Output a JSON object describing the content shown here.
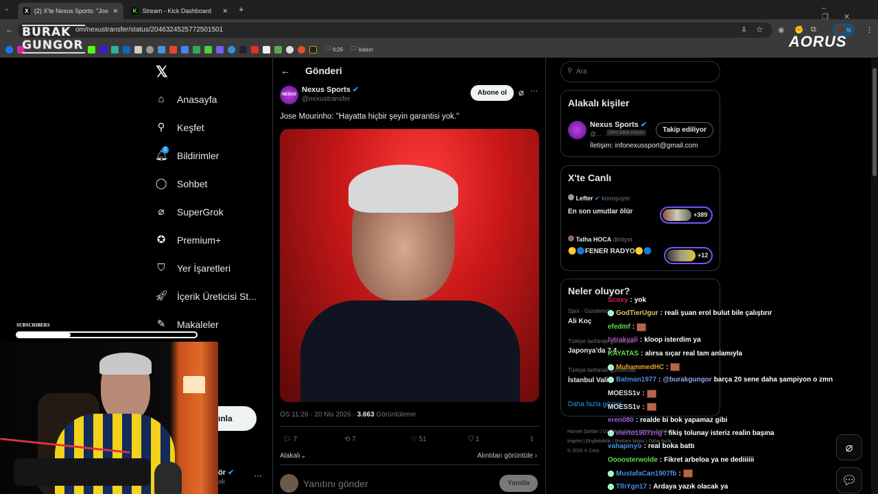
{
  "browser": {
    "tabs": [
      {
        "label": "(2) X'te Nexus Sports: \"Jose Mo",
        "icon": "x-icon",
        "active": true
      },
      {
        "label": "Stream - Kick Dashboard",
        "icon": "kick-icon",
        "active": false
      }
    ],
    "url": "x.com/nexustransfer/status/2046324525772501501",
    "url_visible": "om/nexustransfer/status/2046324525772501501",
    "bookmark_folders": [
      "fc26",
      "kalsın"
    ],
    "profile_badge": "Iş"
  },
  "overlay": {
    "streamer_logo": "BURAK GUNGOR",
    "brand_logo": "AORUS",
    "subscribers_label": "SUBSCRIBERS",
    "subscribers_progress": 0.3
  },
  "nav": {
    "items": [
      {
        "label": "Anasayfa",
        "icon": "home-icon"
      },
      {
        "label": "Keşfet",
        "icon": "search-icon"
      },
      {
        "label": "Bildirimler",
        "icon": "bell-icon",
        "badge": "2"
      },
      {
        "label": "Sohbet",
        "icon": "chat-icon"
      },
      {
        "label": "SuperGrok",
        "icon": "grok-icon"
      },
      {
        "label": "Premium+",
        "icon": "premium-icon"
      },
      {
        "label": "Yer İşaretleri",
        "icon": "bookmark-icon"
      },
      {
        "label": "İçerik Üreticisi St...",
        "icon": "rocket-icon"
      },
      {
        "label": "Makaleler",
        "icon": "article-icon"
      }
    ],
    "post_button_partial": "ınla",
    "account_name_partial": "ör",
    "account_handle_partial": "ak"
  },
  "post": {
    "header": "Gönderi",
    "author": "Nexus Sports",
    "handle": "@nexustransfer",
    "subscribe": "Abone ol",
    "text": "Jose Mourinho: \"Hayatta hiçbir şeyin garantisi yok.\"",
    "time": "ÖS 11:26 · 20 Nis 2026 · ",
    "views": "3.663",
    "views_label": "Görüntüleme",
    "replies": "7",
    "reposts": "7",
    "likes": "51",
    "bookmarks": "1",
    "sort": "Alakalı",
    "quotes": "Alıntıları görüntüle",
    "reply_placeholder": "Yanıtını gönder",
    "reply_button": "Yanıtla"
  },
  "sidebar": {
    "search_placeholder": "Ara",
    "related": {
      "title": "Alakalı kişiler",
      "name": "Nexus Sports",
      "handle": "@...",
      "follows_you": "Seni takip ediyor",
      "follow_button": "Takip ediliyor",
      "bio": "İletişim: infonexussport@gmail.com"
    },
    "live": {
      "title": "X'te Canlı",
      "spaces": [
        {
          "host": "Lefter",
          "status": "konuşuyor",
          "title": "En son umutlar ölür",
          "count": "+389"
        },
        {
          "host": "Talha HOCA",
          "status": "dinliyor",
          "title": "🟡🔵FENER RADYO🟡🔵",
          "count": "+12"
        }
      ]
    },
    "trends": {
      "title": "Neler oluyor?",
      "items": [
        {
          "context": "Spor · Gündemde",
          "name": "Ali Koç"
        },
        {
          "context": "Türkiye tarihinde gündemde",
          "name": "Japonya'da 7.4"
        },
        {
          "context": "Türkiye tarihinde gündemde",
          "name": "İstanbul Vali..."
        }
      ],
      "more": "Daha fazla göster"
    },
    "footer": [
      "Hizmet Şartları",
      "Gizlilik Politikası",
      "Çerez Politikası",
      "Imprint",
      "Erişilebilirlik",
      "Reklam bilgisi",
      "Daha fazla ...",
      "© 2026 X Corp."
    ]
  },
  "chat": [
    {
      "user": "Scoxy",
      "color": "#d0234a",
      "msg": "yok"
    },
    {
      "user": "GodTierUgur",
      "color": "#e8c26a",
      "badge": true,
      "msg": "reali şuan erol bulut bile çalıştırır"
    },
    {
      "user": "efedmf",
      "color": "#5fe04a",
      "emote": true,
      "msg": ""
    },
    {
      "user": "tvtrakyali",
      "color": "#b04cc0",
      "msg": "kloop isterdim ya"
    },
    {
      "user": "KAYATAS",
      "color": "#5fe04a",
      "msg": "alırsa sıçar real tam anlamıyla"
    },
    {
      "user": "MuhammedHC",
      "color": "#e8a030",
      "badge": true,
      "emote": true,
      "msg": ""
    },
    {
      "user": "Batman1977",
      "color": "#4a8fe0",
      "badge": true,
      "mention": "@burakgungor",
      "msg": "barça 20 sene daha şampiyon o zmn"
    },
    {
      "user": "MOESS1v",
      "color": "#dde6f0",
      "emote": true,
      "msg": ""
    },
    {
      "user": "MOESS1v",
      "color": "#dde6f0",
      "emote": true,
      "msg": ""
    },
    {
      "user": "eren080",
      "color": "#a45be0",
      "msg": "realde bi bok yapamaz gibi"
    },
    {
      "user": "merto1907zng",
      "color": "#a45be0",
      "badge": true,
      "msg": "fikiş tolunay isteriz realin başına"
    },
    {
      "user": "vahapinyo",
      "color": "#4a8fe0",
      "msg": "real boka battı"
    },
    {
      "user": "Oooosterwolde",
      "color": "#5fe04a",
      "msg": "Fikret arbeloa ya ne dediiiiii"
    },
    {
      "user": "MustafaCan1907fb",
      "color": "#4a8fe0",
      "badge": true,
      "emote": true,
      "msg": ""
    },
    {
      "user": "TlhYgn17",
      "color": "#4a8fe0",
      "badge": true,
      "msg": "Ardaya yazık olacak ya"
    }
  ],
  "colors": {
    "accent": "#1d9bf0",
    "space_ring": "#7856ff"
  }
}
